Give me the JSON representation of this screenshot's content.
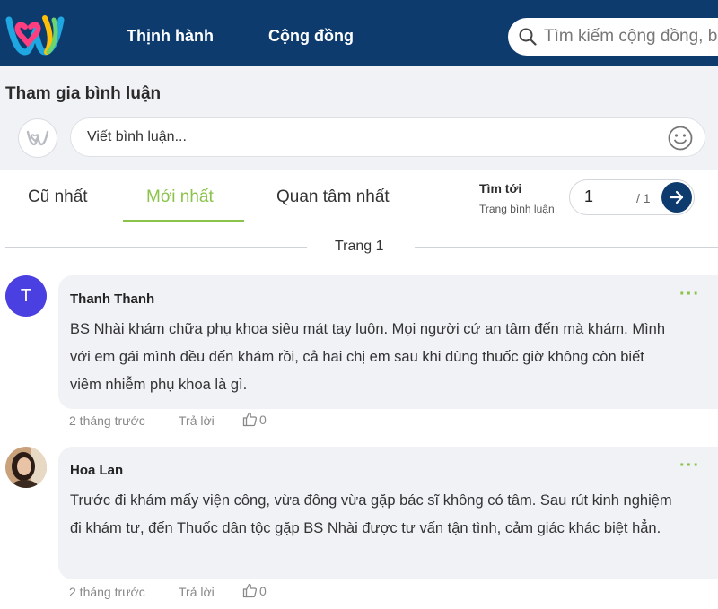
{
  "header": {
    "nav": [
      {
        "label": "Thịnh hành"
      },
      {
        "label": "Cộng đồng"
      }
    ],
    "search": {
      "placeholder": "Tìm kiếm cộng đồng, bài viết"
    }
  },
  "composer": {
    "title": "Tham gia bình luận",
    "placeholder": "Viết bình luận..."
  },
  "sort_tabs": [
    {
      "label": "Cũ nhất",
      "active": false
    },
    {
      "label": "Mới nhất",
      "active": true
    },
    {
      "label": "Quan tâm nhất",
      "active": false
    }
  ],
  "pagination": {
    "title": "Tìm tới",
    "subtitle": "Trang bình luận",
    "current": "1",
    "total": "/ 1"
  },
  "page_separator": "Trang 1",
  "comments": [
    {
      "avatar_letter": "T",
      "author": "Thanh Thanh",
      "text": "BS Nhài khám chữa phụ khoa siêu mát tay luôn. Mọi người cứ an tâm đến mà khám. Mình với em gái mình đều đến khám rồi, cả hai chị em sau khi dùng thuốc giờ không còn biết viêm nhiễm phụ khoa là gì.",
      "time": "2 tháng trước",
      "reply_label": "Trả lời",
      "likes": "0"
    },
    {
      "author": "Hoa Lan",
      "text": "Trước đi khám mấy viện công, vừa đông vừa gặp bác sĩ không có tâm. Sau rút kinh nghiệm đi khám tư, đến Thuốc dân tộc gặp BS Nhài được tư vấn tận tình, cảm giác khác biệt hẳn.",
      "time": "2 tháng trước",
      "reply_label": "Trả lời",
      "likes": "0"
    }
  ],
  "colors": {
    "header_bg": "#0d3b6e",
    "accent_green": "#8bc34a",
    "avatar_purple": "#4a3fe0",
    "bubble_bg": "#f0f2f5"
  }
}
